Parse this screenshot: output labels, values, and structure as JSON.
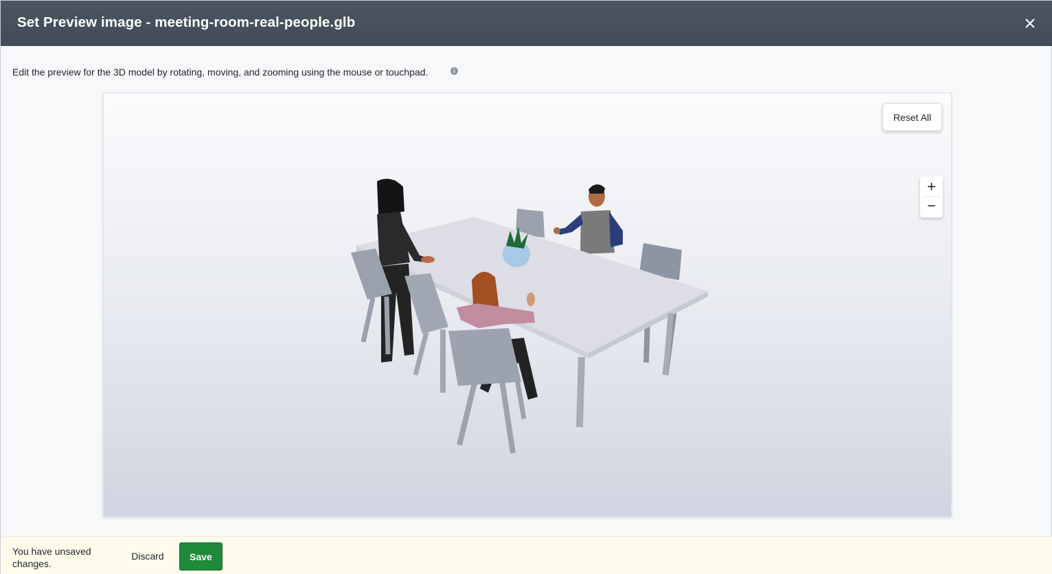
{
  "dialog": {
    "title": "Set Preview image - meeting-room-real-people.glb",
    "description": "Edit the preview for the 3D model by rotating, moving, and zooming using the mouse or touchpad.",
    "info_icon": "info-icon",
    "close_icon": "close-icon"
  },
  "viewer": {
    "reset_label": "Reset All",
    "zoom_in_label": "+",
    "zoom_out_label": "−"
  },
  "footer": {
    "unsaved_message": "You have unsaved changes.",
    "discard_label": "Discard",
    "save_label": "Save"
  },
  "colors": {
    "header": "#454d59",
    "save": "#1e8a3a",
    "footer": "#fdfcec"
  }
}
